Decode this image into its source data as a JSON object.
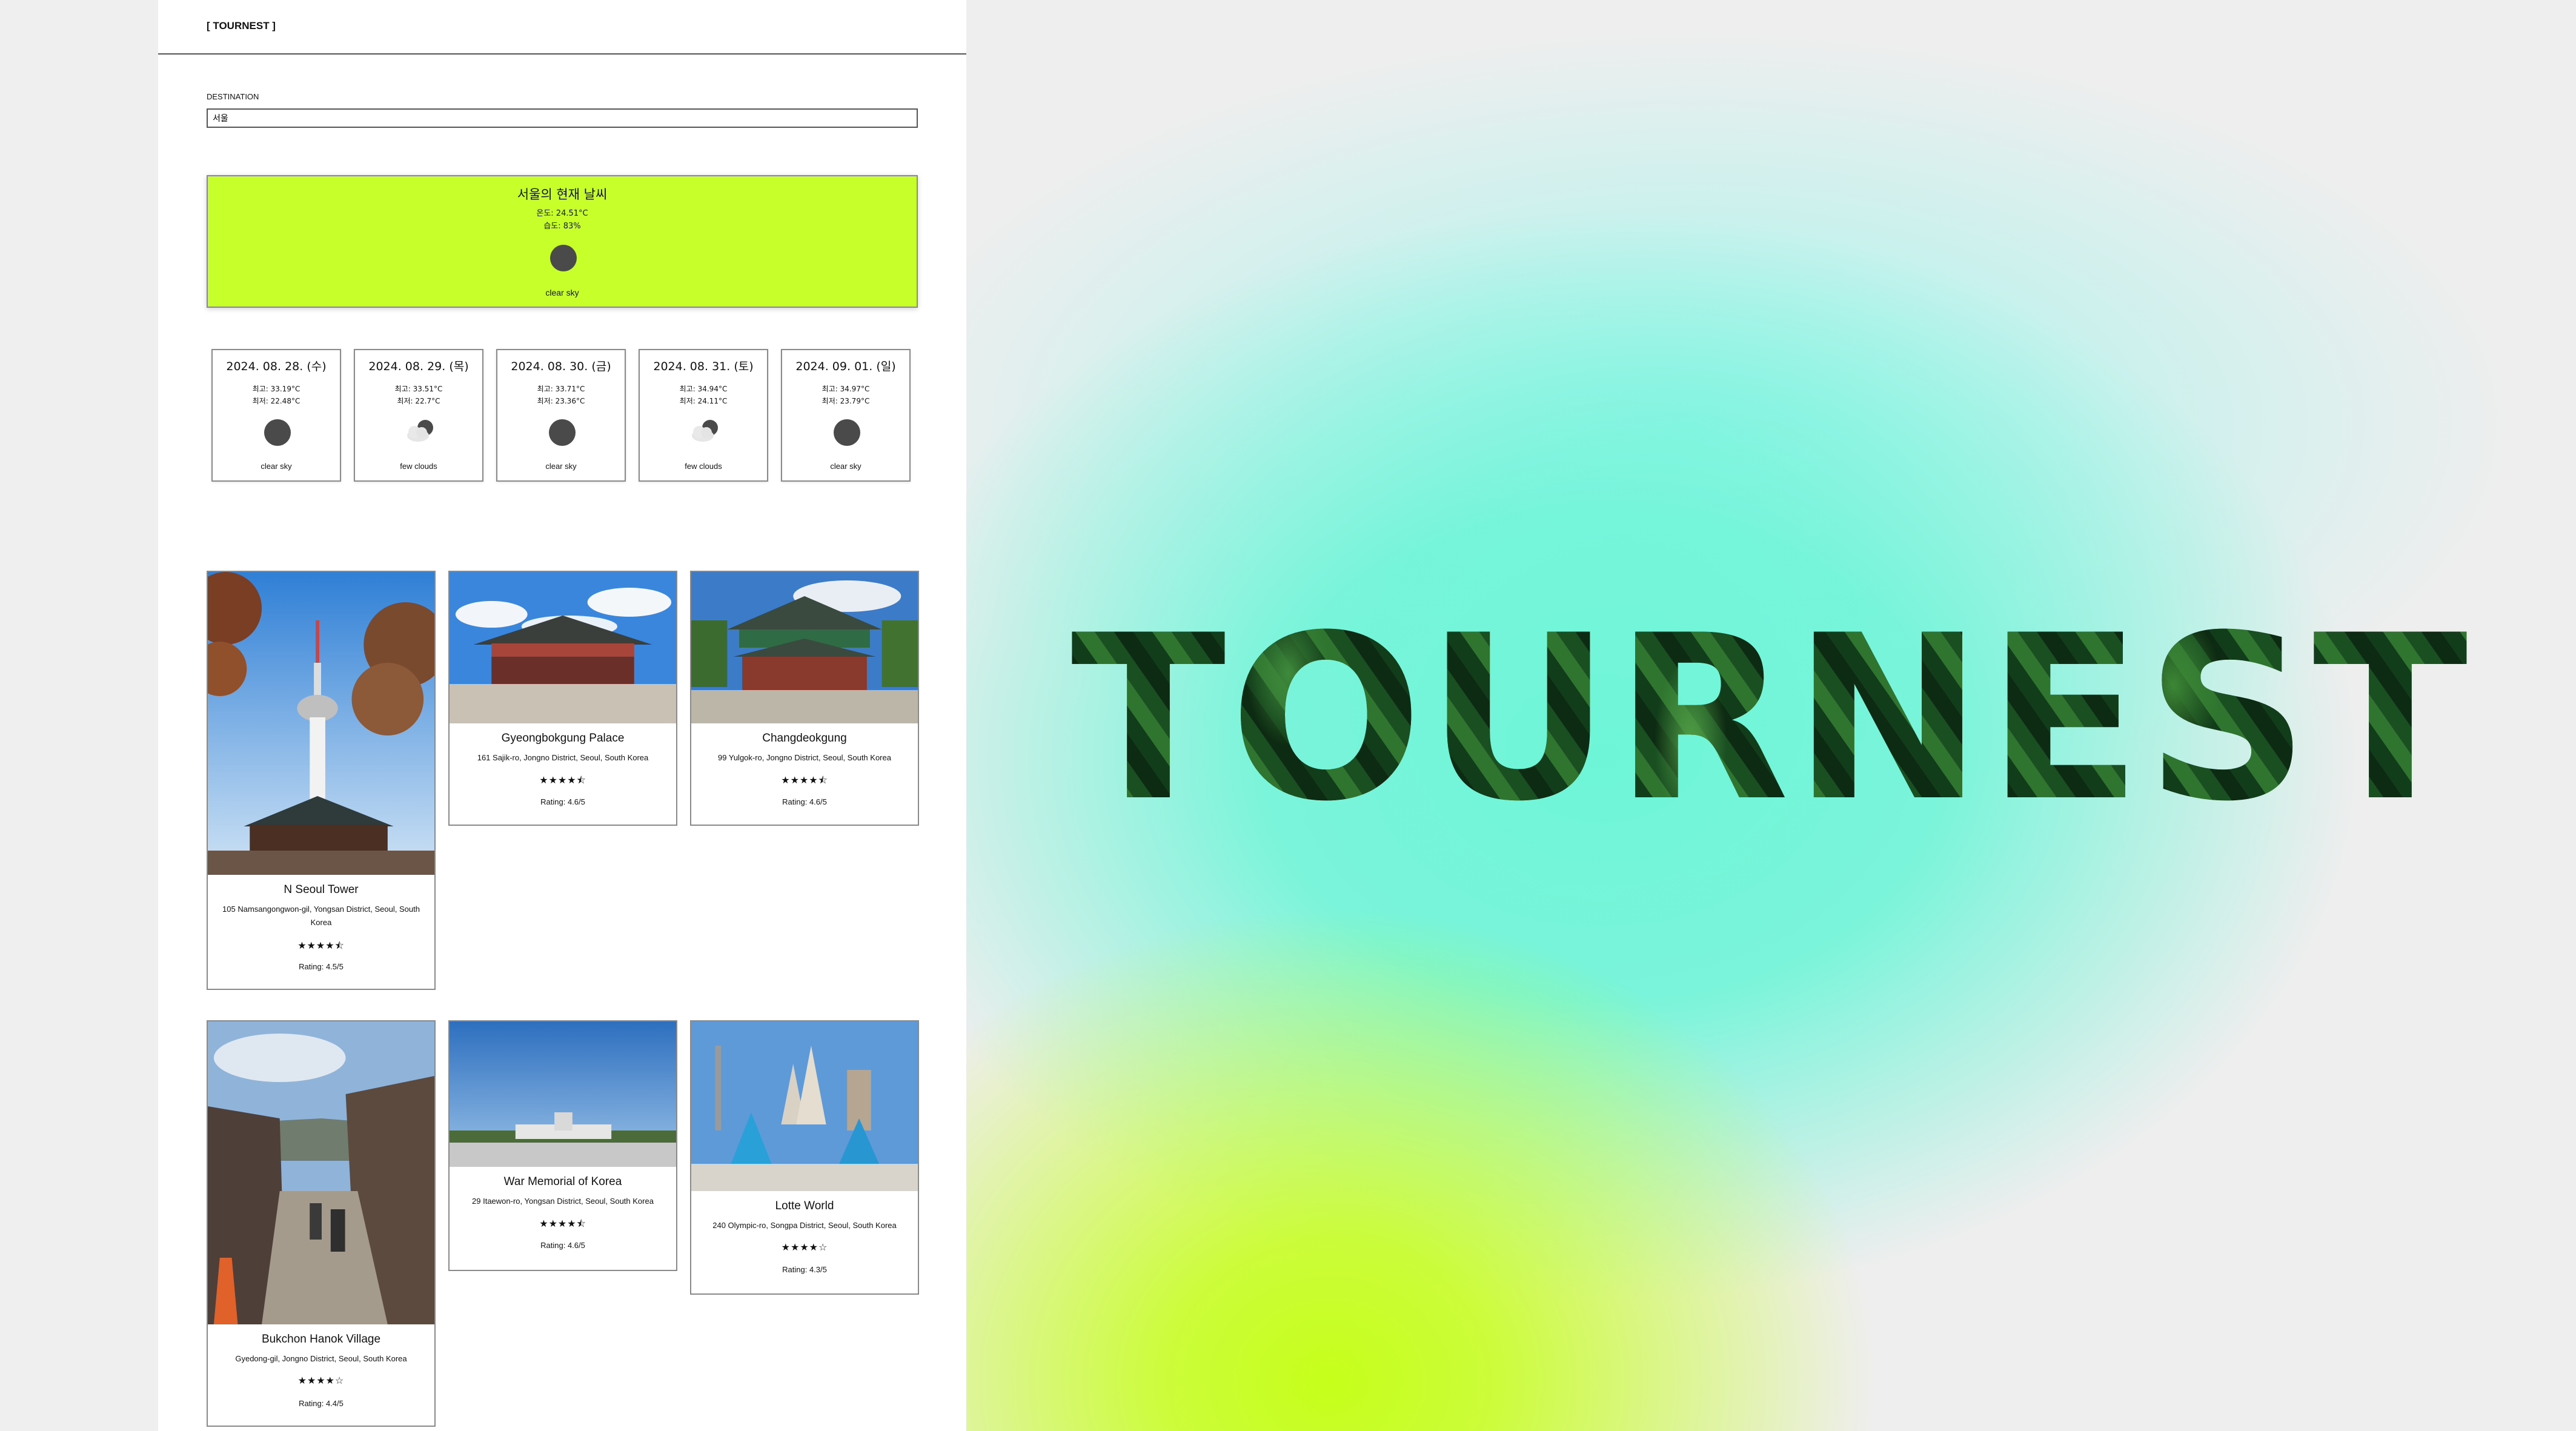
{
  "app": {
    "brand": "[ TOURNEST ]",
    "destination_label": "DESTINATION",
    "destination_value": "서울"
  },
  "current_weather": {
    "title": "서울의 현재 날씨",
    "temperature": "온도: 24.51°C",
    "humidity": "습도: 83%",
    "icon": "clear-sky-icon",
    "description": "clear sky"
  },
  "forecast": [
    {
      "date": "2024. 08. 28. (수)",
      "high": "최고: 33.19°C",
      "low": "최저: 22.48°C",
      "icon": "clear-sky-icon",
      "description": "clear sky"
    },
    {
      "date": "2024. 08. 29. (목)",
      "high": "최고: 33.51°C",
      "low": "최저: 22.7°C",
      "icon": "few-clouds-icon",
      "description": "few clouds"
    },
    {
      "date": "2024. 08. 30. (금)",
      "high": "최고: 33.71°C",
      "low": "최저: 23.36°C",
      "icon": "clear-sky-icon",
      "description": "clear sky"
    },
    {
      "date": "2024. 08. 31. (토)",
      "high": "최고: 34.94°C",
      "low": "최저: 24.11°C",
      "icon": "few-clouds-icon",
      "description": "few clouds"
    },
    {
      "date": "2024. 09. 01. (일)",
      "high": "최고: 34.97°C",
      "low": "최저: 23.79°C",
      "icon": "clear-sky-icon",
      "description": "clear sky"
    }
  ],
  "places": [
    {
      "name": "N Seoul Tower",
      "address": "105 Namsangongwon-gil, Yongsan District, Seoul, South Korea",
      "stars": "★★★★⯪",
      "rating_value": 4.5,
      "rating": "Rating: 4.5/5"
    },
    {
      "name": "Gyeongbokgung Palace",
      "address": "161 Sajik-ro, Jongno District, Seoul, South Korea",
      "stars": "★★★★⯪",
      "rating_value": 4.6,
      "rating": "Rating: 4.6/5"
    },
    {
      "name": "Changdeokgung",
      "address": "99 Yulgok-ro, Jongno District, Seoul, South Korea",
      "stars": "★★★★⯪",
      "rating_value": 4.6,
      "rating": "Rating: 4.6/5"
    },
    {
      "name": "Bukchon Hanok Village",
      "address": "Gyedong-gil, Jongno District, Seoul, South Korea",
      "stars": "★★★★☆",
      "rating_value": 4.4,
      "rating": "Rating: 4.4/5"
    },
    {
      "name": "War Memorial of Korea",
      "address": "29 Itaewon-ro, Yongsan District, Seoul, South Korea",
      "stars": "★★★★⯪",
      "rating_value": 4.6,
      "rating": "Rating: 4.6/5"
    },
    {
      "name": "Lotte World",
      "address": "240 Olympic-ro, Songpa District, Seoul, South Korea",
      "stars": "★★★★☆",
      "rating_value": 4.3,
      "rating": "Rating: 4.3/5"
    }
  ],
  "hero": {
    "title": "TOURNEST"
  },
  "colors": {
    "accent": "#c6ff2a",
    "hero_lime": "#c6ff1a",
    "hero_mint": "#6ef5d8",
    "text": "#111111"
  }
}
